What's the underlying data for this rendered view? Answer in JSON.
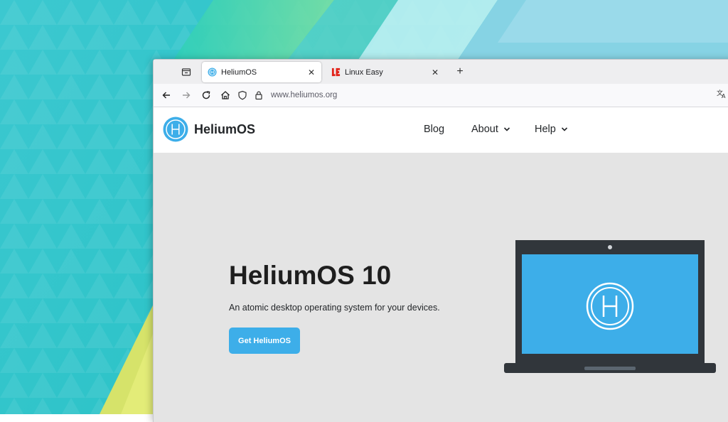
{
  "tabs": [
    {
      "title": "HeliumOS",
      "active": true,
      "favicon": "helium-logo"
    },
    {
      "title": "Linux Easy",
      "active": false,
      "favicon": "LE"
    }
  ],
  "address_bar": {
    "url": "www.heliumos.org"
  },
  "site": {
    "brand": "HeliumOS",
    "nav": [
      {
        "label": "Blog"
      },
      {
        "label": "About",
        "dropdown": true
      },
      {
        "label": "Help",
        "dropdown": true
      }
    ],
    "hero": {
      "title": "HeliumOS 10",
      "subtitle": "An atomic desktop operating system for your devices.",
      "cta": "Get HeliumOS"
    },
    "laptop_screen_logo": "H"
  },
  "colors": {
    "accent": "#3daee9",
    "page_background": "#e4e4e4",
    "laptop_frame": "#31363b",
    "favicon_le": "#e2231a"
  },
  "icons": [
    "tab-list-icon",
    "close-icon",
    "plus-icon",
    "back-arrow-icon",
    "forward-arrow-icon",
    "reload-icon",
    "home-icon",
    "shield-icon",
    "lock-icon",
    "translate-icon",
    "chevron-down-icon"
  ]
}
